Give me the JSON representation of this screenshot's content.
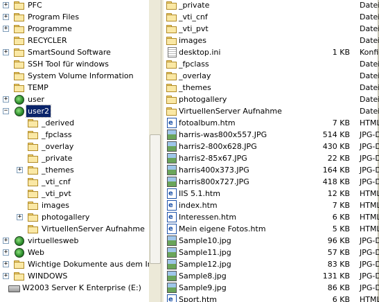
{
  "tree": {
    "items": [
      {
        "label": "PFC",
        "expander": "+",
        "icon": "folder-icon",
        "depth": 0
      },
      {
        "label": "Program Files",
        "expander": "+",
        "icon": "folder-icon",
        "depth": 0
      },
      {
        "label": "Programme",
        "expander": "+",
        "icon": "folder-icon",
        "depth": 0
      },
      {
        "label": "RECYCLER",
        "expander": "",
        "icon": "folder-icon",
        "depth": 0
      },
      {
        "label": "SmartSound Software",
        "expander": "+",
        "icon": "folder-icon",
        "depth": 0
      },
      {
        "label": "SSH Tool für windows",
        "expander": "",
        "icon": "folder-icon",
        "depth": 0
      },
      {
        "label": "System Volume Information",
        "expander": "",
        "icon": "folder-icon",
        "depth": 0
      },
      {
        "label": "TEMP",
        "expander": "",
        "icon": "folder-icon",
        "depth": 0
      },
      {
        "label": "user",
        "expander": "+",
        "icon": "web-folder-icon",
        "depth": 0
      },
      {
        "label": "user2",
        "expander": "−",
        "icon": "web-folder-icon",
        "depth": 0,
        "selected": true
      },
      {
        "label": "_derived",
        "expander": "",
        "icon": "folder-icon",
        "depth": 1
      },
      {
        "label": "_fpclass",
        "expander": "",
        "icon": "folder-icon",
        "depth": 1
      },
      {
        "label": "_overlay",
        "expander": "",
        "icon": "folder-icon",
        "depth": 1
      },
      {
        "label": "_private",
        "expander": "",
        "icon": "folder-icon",
        "depth": 1
      },
      {
        "label": "_themes",
        "expander": "+",
        "icon": "folder-icon",
        "depth": 1
      },
      {
        "label": "_vti_cnf",
        "expander": "",
        "icon": "folder-icon",
        "depth": 1
      },
      {
        "label": "_vti_pvt",
        "expander": "",
        "icon": "folder-icon",
        "depth": 1
      },
      {
        "label": "images",
        "expander": "",
        "icon": "folder-icon",
        "depth": 1
      },
      {
        "label": "photogallery",
        "expander": "+",
        "icon": "folder-icon",
        "depth": 1
      },
      {
        "label": "VirtuellenServer Aufnahme",
        "expander": "",
        "icon": "folder-icon",
        "depth": 1
      },
      {
        "label": "virtuellesweb",
        "expander": "+",
        "icon": "web-folder-icon",
        "depth": 0
      },
      {
        "label": "Web",
        "expander": "+",
        "icon": "web-folder-icon",
        "depth": 0
      },
      {
        "label": "Wichtige Dokumente aus dem Intern",
        "expander": "+",
        "icon": "folder-icon",
        "depth": 0
      },
      {
        "label": "WINDOWS",
        "expander": "+",
        "icon": "folder-icon",
        "depth": 0
      },
      {
        "label": "W2003 Server K Enterprise (E:)",
        "expander": "",
        "icon": "drive-icon",
        "depth": -1
      }
    ]
  },
  "files": [
    {
      "name": "_private",
      "size": "",
      "type": "Dateio",
      "icon": "folder-icon"
    },
    {
      "name": "_vti_cnf",
      "size": "",
      "type": "Dateio",
      "icon": "folder-icon"
    },
    {
      "name": "_vti_pvt",
      "size": "",
      "type": "Dateio",
      "icon": "folder-icon"
    },
    {
      "name": "images",
      "size": "",
      "type": "Dateio",
      "icon": "folder-icon"
    },
    {
      "name": "desktop.ini",
      "size": "1 KB",
      "type": "Konfig",
      "icon": "ini-file-icon"
    },
    {
      "name": "_fpclass",
      "size": "",
      "type": "Dateio",
      "icon": "folder-icon"
    },
    {
      "name": "_overlay",
      "size": "",
      "type": "Dateio",
      "icon": "folder-icon"
    },
    {
      "name": "_themes",
      "size": "",
      "type": "Dateio",
      "icon": "folder-icon"
    },
    {
      "name": "photogallery",
      "size": "",
      "type": "Dateio",
      "icon": "folder-icon"
    },
    {
      "name": "VirtuellenServer Aufnahme",
      "size": "",
      "type": "Dateio",
      "icon": "folder-icon"
    },
    {
      "name": "fotoalbum.htm",
      "size": "7 KB",
      "type": "HTML",
      "icon": "html-file-icon"
    },
    {
      "name": "harris-was800x557.JPG",
      "size": "514 KB",
      "type": "JPG-D",
      "icon": "image-file-icon"
    },
    {
      "name": "harris2-800x628.JPG",
      "size": "430 KB",
      "type": "JPG-D",
      "icon": "image-file-icon"
    },
    {
      "name": "harris2-85x67.JPG",
      "size": "22 KB",
      "type": "JPG-D",
      "icon": "image-file-icon"
    },
    {
      "name": "harris400x373.JPG",
      "size": "164 KB",
      "type": "JPG-D",
      "icon": "image-file-icon"
    },
    {
      "name": "harris800x727.JPG",
      "size": "418 KB",
      "type": "JPG-D",
      "icon": "image-file-icon"
    },
    {
      "name": "IIS 5.1.htm",
      "size": "12 KB",
      "type": "HTML",
      "icon": "html-file-icon"
    },
    {
      "name": "index.htm",
      "size": "7 KB",
      "type": "HTML",
      "icon": "html-file-icon"
    },
    {
      "name": "Interessen.htm",
      "size": "6 KB",
      "type": "HTML",
      "icon": "html-file-icon"
    },
    {
      "name": "Mein eigene Fotos.htm",
      "size": "5 KB",
      "type": "HTML",
      "icon": "html-file-icon"
    },
    {
      "name": "Sample10.jpg",
      "size": "96 KB",
      "type": "JPG-D",
      "icon": "image-file-icon"
    },
    {
      "name": "Sample11.jpg",
      "size": "57 KB",
      "type": "JPG-D",
      "icon": "image-file-icon"
    },
    {
      "name": "Sample12.jpg",
      "size": "83 KB",
      "type": "JPG-D",
      "icon": "image-file-icon"
    },
    {
      "name": "Sample8.jpg",
      "size": "131 KB",
      "type": "JPG-D",
      "icon": "image-file-icon"
    },
    {
      "name": "Sample9.jpg",
      "size": "86 KB",
      "type": "JPG-D",
      "icon": "image-file-icon"
    },
    {
      "name": "Sport.htm",
      "size": "6 KB",
      "type": "HTML",
      "icon": "html-file-icon"
    }
  ],
  "colors": {
    "selection": "#0a246a",
    "window_bg": "#ffffff",
    "chrome": "#ece9d8"
  }
}
